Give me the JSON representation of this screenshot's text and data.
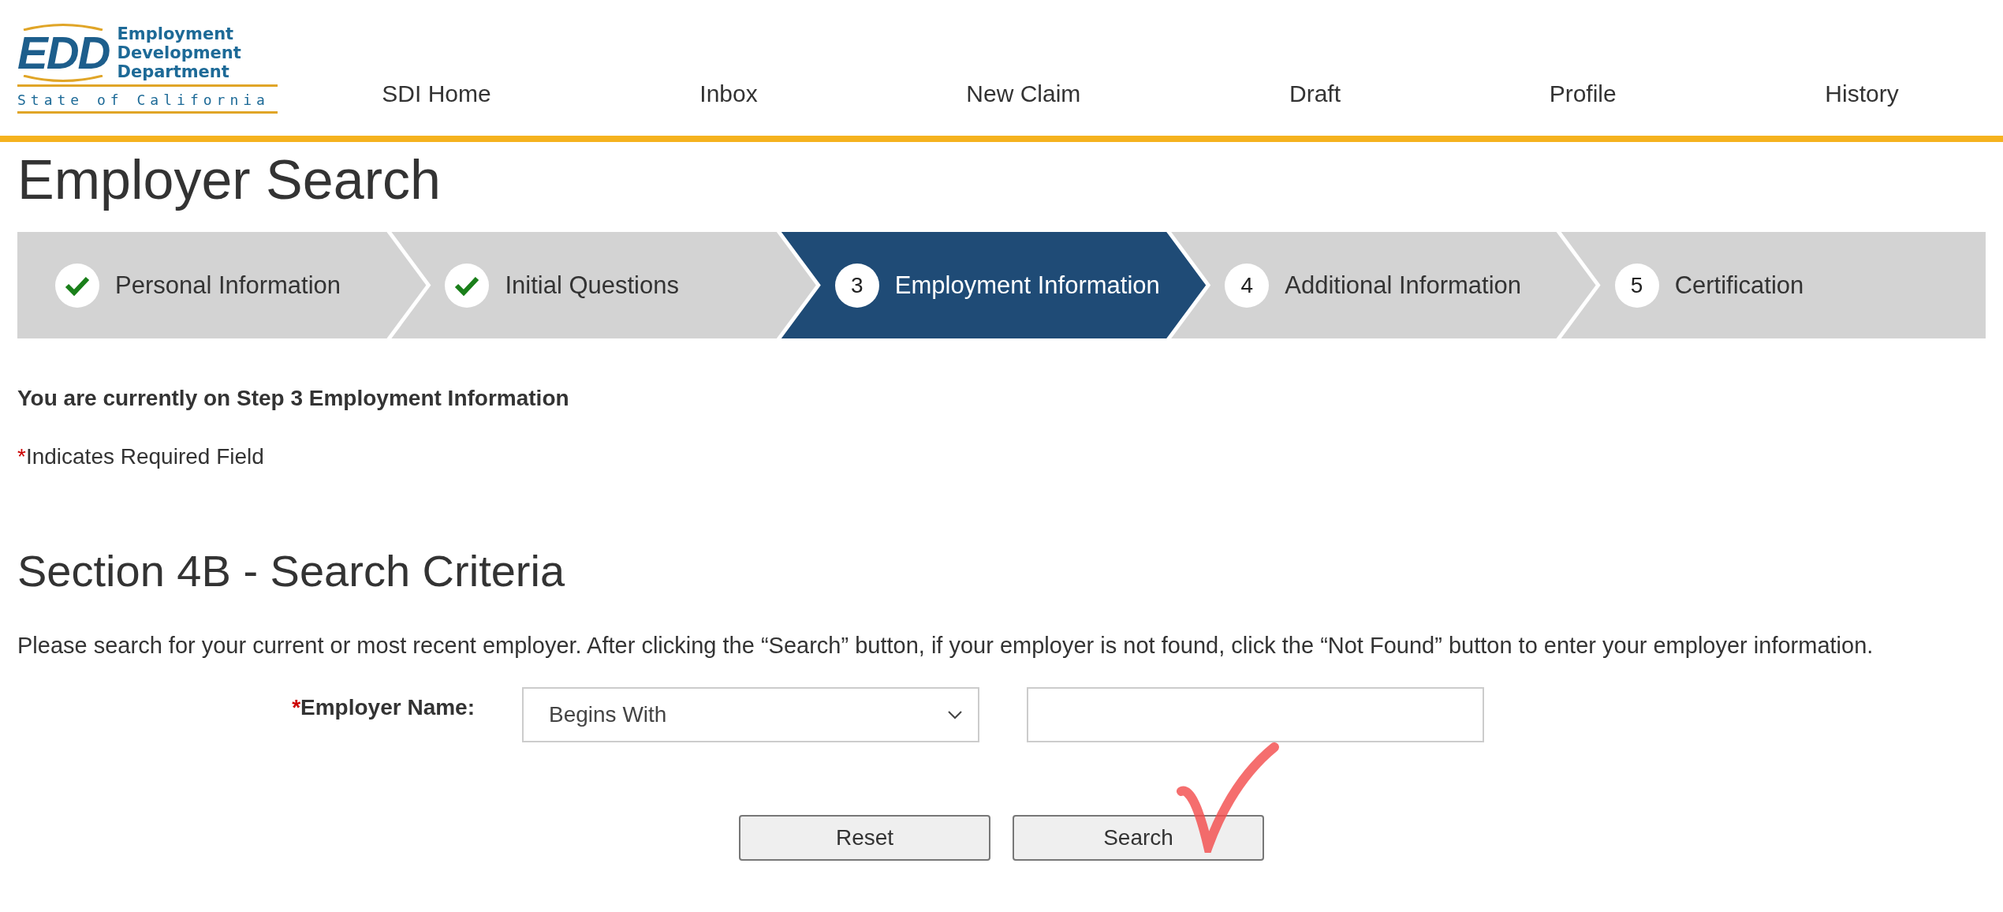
{
  "logo": {
    "mark": "EDD",
    "name_lines": [
      "Employment",
      "Development",
      "Department"
    ],
    "state": "State of California"
  },
  "nav": [
    {
      "label": "SDI Home"
    },
    {
      "label": "Inbox"
    },
    {
      "label": "New Claim"
    },
    {
      "label": "Draft"
    },
    {
      "label": "Profile"
    },
    {
      "label": "History"
    }
  ],
  "title": "Employer Search",
  "steps": [
    {
      "label": "Personal Information",
      "completed": true,
      "selected": false
    },
    {
      "label": "Initial Questions",
      "completed": true,
      "selected": false
    },
    {
      "number": "3",
      "label": "Employment Information",
      "completed": false,
      "selected": true
    },
    {
      "number": "4",
      "label": "Additional Information",
      "completed": false,
      "selected": false
    },
    {
      "number": "5",
      "label": "Certification",
      "completed": false,
      "selected": false
    }
  ],
  "current_step_note": "You are currently on Step 3 Employment Information",
  "required_note": {
    "mark": "*",
    "text": "Indicates Required Field"
  },
  "section_title": "Section 4B - Search Criteria",
  "instructions": "Please search for your current or most recent employer. After clicking the “Search” button, if your employer is not found, click the “Not Found” button to enter your employer information.",
  "employer_field": {
    "required_mark": "*",
    "label": "Employer Name:",
    "match_type": "Begins With"
  },
  "buttons": [
    {
      "label": "Reset",
      "annotated": false
    },
    {
      "label": "Search",
      "annotated": true
    }
  ]
}
